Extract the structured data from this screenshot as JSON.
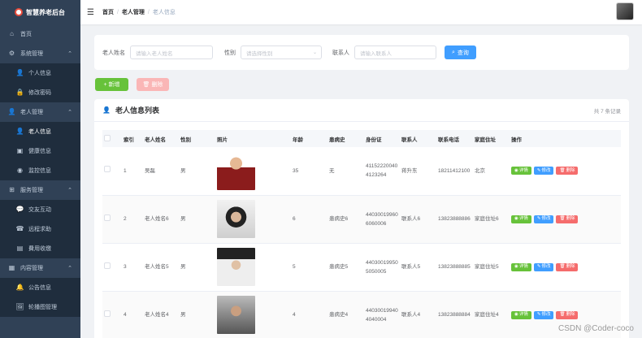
{
  "app": {
    "title": "智慧养老后台"
  },
  "sidebar": {
    "home": "首页",
    "groups": [
      {
        "label": "系统管理",
        "items": [
          "个人信息",
          "修改密码"
        ]
      },
      {
        "label": "老人管理",
        "items": [
          "老人信息",
          "健康信息",
          "监控信息"
        ]
      },
      {
        "label": "服务管理",
        "items": [
          "交友互动",
          "远程求助",
          "費用收缴"
        ]
      },
      {
        "label": "内容管理",
        "items": [
          "公告信息",
          "轮播图管理"
        ]
      }
    ]
  },
  "header": {
    "breadcrumb": [
      "首页",
      "老人管理",
      "老人信息"
    ]
  },
  "search": {
    "name_label": "老人姓名",
    "name_placeholder": "请输入老人姓名",
    "gender_label": "性别",
    "gender_placeholder": "请选择性别",
    "contact_label": "联系人",
    "contact_placeholder": "请输入联系人",
    "query_label": "查询"
  },
  "actions": {
    "add_label": "新增",
    "delete_label": "删除"
  },
  "list": {
    "title": "老人信息列表",
    "count_text": "共 7 条记录",
    "columns": [
      "索引",
      "老人姓名",
      "性别",
      "照片",
      "年龄",
      "患病史",
      "身份证",
      "联系人",
      "联系电话",
      "家庭住址",
      "操作"
    ],
    "rows": [
      {
        "index": "1",
        "name": "吴磊",
        "gender": "男",
        "age": "35",
        "history": "无",
        "id_card": "411522200404123264",
        "contact": "蒋升东",
        "phone": "18211412100",
        "address": "北京"
      },
      {
        "index": "2",
        "name": "老人姓名6",
        "gender": "男",
        "age": "6",
        "history": "患病史6",
        "id_card": "440300199606060006",
        "contact": "联系人6",
        "phone": "13823888886",
        "address": "家庭住址6"
      },
      {
        "index": "3",
        "name": "老人姓名5",
        "gender": "男",
        "age": "5",
        "history": "患病史5",
        "id_card": "440300199505050005",
        "contact": "联系人5",
        "phone": "13823888885",
        "address": "家庭住址5"
      },
      {
        "index": "4",
        "name": "老人姓名4",
        "gender": "男",
        "age": "4",
        "history": "患病史4",
        "id_card": "440300199404040004",
        "contact": "联系人4",
        "phone": "13823888884",
        "address": "家庭住址4"
      }
    ],
    "op_labels": {
      "view": "详情",
      "edit": "修改",
      "remove": "删除"
    }
  },
  "watermark": "CSDN @Coder-coco",
  "colors": {
    "sidebar_bg": "#304156",
    "primary": "#409eff",
    "success": "#67c23a",
    "danger": "#f56c6c"
  }
}
